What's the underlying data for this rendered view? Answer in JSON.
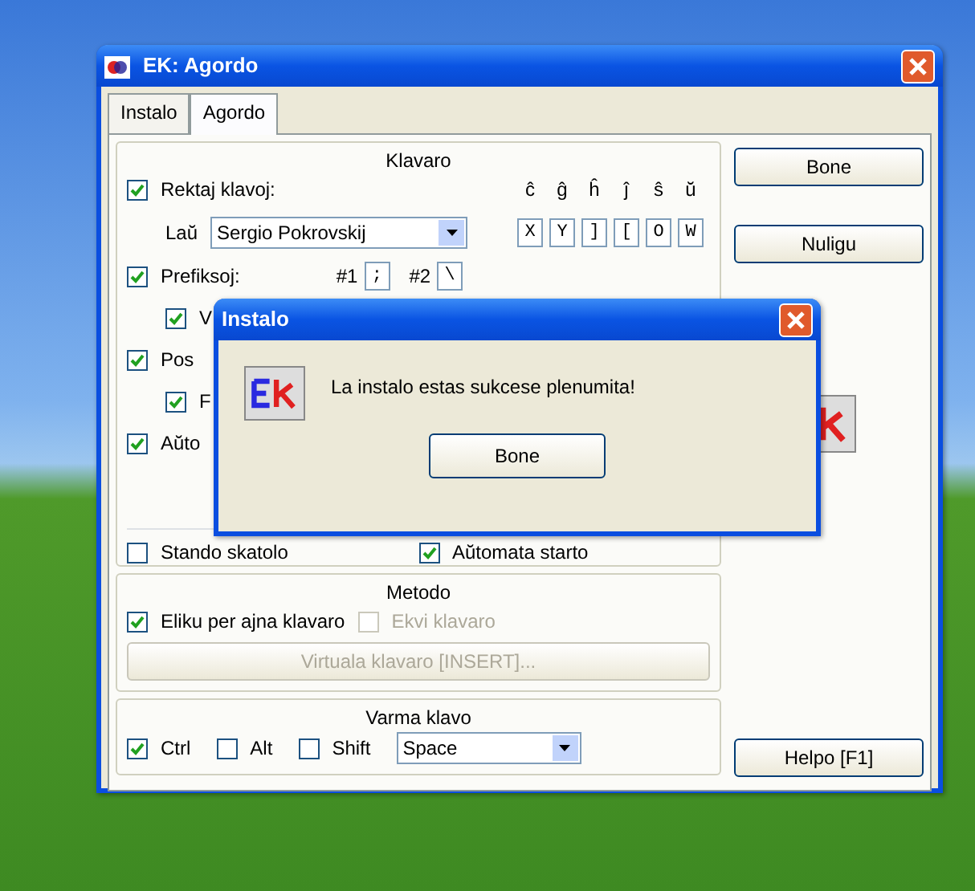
{
  "main_window": {
    "title": "EK: Agordo",
    "tabs": [
      {
        "label": "Instalo",
        "selected": false
      },
      {
        "label": "Agordo",
        "selected": true
      }
    ],
    "klavaro": {
      "legend": "Klavaro",
      "direct": {
        "label": "Rektaj klavoj:",
        "checked": true
      },
      "letters": [
        "ĉ",
        "ĝ",
        "ĥ",
        "ĵ",
        "ŝ",
        "ŭ"
      ],
      "keys": [
        "X",
        "Y",
        "]",
        "[",
        "O",
        "W"
      ],
      "layout_label": "Laŭ",
      "layout_value": "Sergio Pokrovskij",
      "prefixes": {
        "label": "Prefiksoj:",
        "checked": true,
        "p1_label": "#1",
        "p1_value": ";",
        "p2_label": "#2",
        "p2_value": "\\",
        "children": [
          {
            "label": "V",
            "checked": true
          }
        ]
      },
      "options": [
        {
          "label": "Pos",
          "checked": true,
          "children": [
            {
              "label": "F",
              "checked": true
            }
          ]
        },
        {
          "label": "Aŭto",
          "checked": true
        }
      ],
      "bottom": [
        {
          "label": "Stando skatolo",
          "checked": false
        },
        {
          "label": "Aŭtomata starto",
          "checked": true
        }
      ]
    },
    "metodo": {
      "legend": "Metodo",
      "options": [
        {
          "label": "Eliku per ajna klavaro",
          "checked": true,
          "disabled": false
        },
        {
          "label": "Ekvi klavaro",
          "checked": false,
          "disabled": true
        }
      ],
      "button": {
        "label": "Virtuala klavaro [INSERT]...",
        "disabled": true
      }
    },
    "varma_klavo": {
      "legend": "Varma klavo",
      "modifiers": [
        {
          "label": "Ctrl",
          "checked": true
        },
        {
          "label": "Alt",
          "checked": false
        },
        {
          "label": "Shift",
          "checked": false
        }
      ],
      "key": "Space"
    },
    "buttons": [
      "Bone",
      "Nuligu"
    ],
    "help_button": "Helpo [F1]"
  },
  "popup": {
    "title": "Instalo",
    "message": "La instalo estas sukcese plenumita!",
    "button": "Bone"
  }
}
